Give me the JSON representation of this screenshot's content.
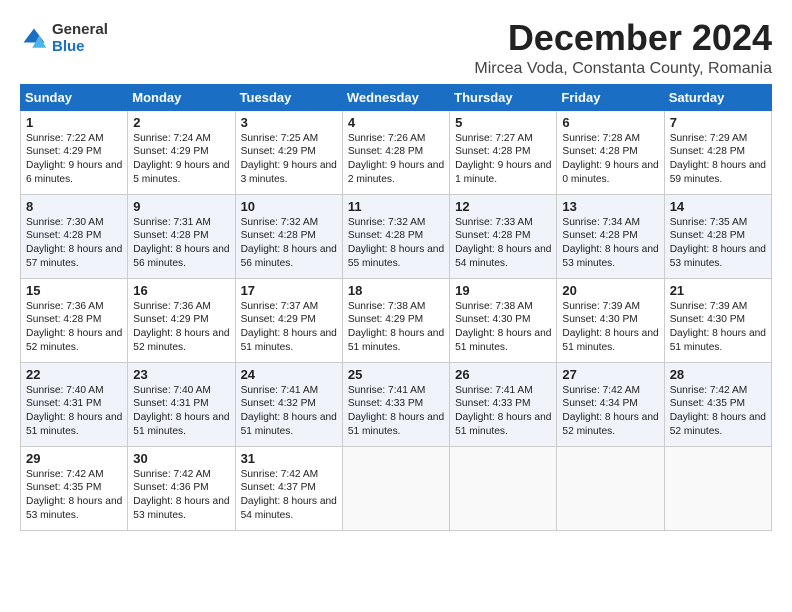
{
  "logo": {
    "general": "General",
    "blue": "Blue"
  },
  "header": {
    "title": "December 2024",
    "location": "Mircea Voda, Constanta County, Romania"
  },
  "columns": [
    "Sunday",
    "Monday",
    "Tuesday",
    "Wednesday",
    "Thursday",
    "Friday",
    "Saturday"
  ],
  "weeks": [
    [
      {
        "day": "1",
        "sunrise": "Sunrise: 7:22 AM",
        "sunset": "Sunset: 4:29 PM",
        "daylight": "Daylight: 9 hours and 6 minutes."
      },
      {
        "day": "2",
        "sunrise": "Sunrise: 7:24 AM",
        "sunset": "Sunset: 4:29 PM",
        "daylight": "Daylight: 9 hours and 5 minutes."
      },
      {
        "day": "3",
        "sunrise": "Sunrise: 7:25 AM",
        "sunset": "Sunset: 4:29 PM",
        "daylight": "Daylight: 9 hours and 3 minutes."
      },
      {
        "day": "4",
        "sunrise": "Sunrise: 7:26 AM",
        "sunset": "Sunset: 4:28 PM",
        "daylight": "Daylight: 9 hours and 2 minutes."
      },
      {
        "day": "5",
        "sunrise": "Sunrise: 7:27 AM",
        "sunset": "Sunset: 4:28 PM",
        "daylight": "Daylight: 9 hours and 1 minute."
      },
      {
        "day": "6",
        "sunrise": "Sunrise: 7:28 AM",
        "sunset": "Sunset: 4:28 PM",
        "daylight": "Daylight: 9 hours and 0 minutes."
      },
      {
        "day": "7",
        "sunrise": "Sunrise: 7:29 AM",
        "sunset": "Sunset: 4:28 PM",
        "daylight": "Daylight: 8 hours and 59 minutes."
      }
    ],
    [
      {
        "day": "8",
        "sunrise": "Sunrise: 7:30 AM",
        "sunset": "Sunset: 4:28 PM",
        "daylight": "Daylight: 8 hours and 57 minutes."
      },
      {
        "day": "9",
        "sunrise": "Sunrise: 7:31 AM",
        "sunset": "Sunset: 4:28 PM",
        "daylight": "Daylight: 8 hours and 56 minutes."
      },
      {
        "day": "10",
        "sunrise": "Sunrise: 7:32 AM",
        "sunset": "Sunset: 4:28 PM",
        "daylight": "Daylight: 8 hours and 56 minutes."
      },
      {
        "day": "11",
        "sunrise": "Sunrise: 7:32 AM",
        "sunset": "Sunset: 4:28 PM",
        "daylight": "Daylight: 8 hours and 55 minutes."
      },
      {
        "day": "12",
        "sunrise": "Sunrise: 7:33 AM",
        "sunset": "Sunset: 4:28 PM",
        "daylight": "Daylight: 8 hours and 54 minutes."
      },
      {
        "day": "13",
        "sunrise": "Sunrise: 7:34 AM",
        "sunset": "Sunset: 4:28 PM",
        "daylight": "Daylight: 8 hours and 53 minutes."
      },
      {
        "day": "14",
        "sunrise": "Sunrise: 7:35 AM",
        "sunset": "Sunset: 4:28 PM",
        "daylight": "Daylight: 8 hours and 53 minutes."
      }
    ],
    [
      {
        "day": "15",
        "sunrise": "Sunrise: 7:36 AM",
        "sunset": "Sunset: 4:28 PM",
        "daylight": "Daylight: 8 hours and 52 minutes."
      },
      {
        "day": "16",
        "sunrise": "Sunrise: 7:36 AM",
        "sunset": "Sunset: 4:29 PM",
        "daylight": "Daylight: 8 hours and 52 minutes."
      },
      {
        "day": "17",
        "sunrise": "Sunrise: 7:37 AM",
        "sunset": "Sunset: 4:29 PM",
        "daylight": "Daylight: 8 hours and 51 minutes."
      },
      {
        "day": "18",
        "sunrise": "Sunrise: 7:38 AM",
        "sunset": "Sunset: 4:29 PM",
        "daylight": "Daylight: 8 hours and 51 minutes."
      },
      {
        "day": "19",
        "sunrise": "Sunrise: 7:38 AM",
        "sunset": "Sunset: 4:30 PM",
        "daylight": "Daylight: 8 hours and 51 minutes."
      },
      {
        "day": "20",
        "sunrise": "Sunrise: 7:39 AM",
        "sunset": "Sunset: 4:30 PM",
        "daylight": "Daylight: 8 hours and 51 minutes."
      },
      {
        "day": "21",
        "sunrise": "Sunrise: 7:39 AM",
        "sunset": "Sunset: 4:30 PM",
        "daylight": "Daylight: 8 hours and 51 minutes."
      }
    ],
    [
      {
        "day": "22",
        "sunrise": "Sunrise: 7:40 AM",
        "sunset": "Sunset: 4:31 PM",
        "daylight": "Daylight: 8 hours and 51 minutes."
      },
      {
        "day": "23",
        "sunrise": "Sunrise: 7:40 AM",
        "sunset": "Sunset: 4:31 PM",
        "daylight": "Daylight: 8 hours and 51 minutes."
      },
      {
        "day": "24",
        "sunrise": "Sunrise: 7:41 AM",
        "sunset": "Sunset: 4:32 PM",
        "daylight": "Daylight: 8 hours and 51 minutes."
      },
      {
        "day": "25",
        "sunrise": "Sunrise: 7:41 AM",
        "sunset": "Sunset: 4:33 PM",
        "daylight": "Daylight: 8 hours and 51 minutes."
      },
      {
        "day": "26",
        "sunrise": "Sunrise: 7:41 AM",
        "sunset": "Sunset: 4:33 PM",
        "daylight": "Daylight: 8 hours and 51 minutes."
      },
      {
        "day": "27",
        "sunrise": "Sunrise: 7:42 AM",
        "sunset": "Sunset: 4:34 PM",
        "daylight": "Daylight: 8 hours and 52 minutes."
      },
      {
        "day": "28",
        "sunrise": "Sunrise: 7:42 AM",
        "sunset": "Sunset: 4:35 PM",
        "daylight": "Daylight: 8 hours and 52 minutes."
      }
    ],
    [
      {
        "day": "29",
        "sunrise": "Sunrise: 7:42 AM",
        "sunset": "Sunset: 4:35 PM",
        "daylight": "Daylight: 8 hours and 53 minutes."
      },
      {
        "day": "30",
        "sunrise": "Sunrise: 7:42 AM",
        "sunset": "Sunset: 4:36 PM",
        "daylight": "Daylight: 8 hours and 53 minutes."
      },
      {
        "day": "31",
        "sunrise": "Sunrise: 7:42 AM",
        "sunset": "Sunset: 4:37 PM",
        "daylight": "Daylight: 8 hours and 54 minutes."
      },
      null,
      null,
      null,
      null
    ]
  ]
}
